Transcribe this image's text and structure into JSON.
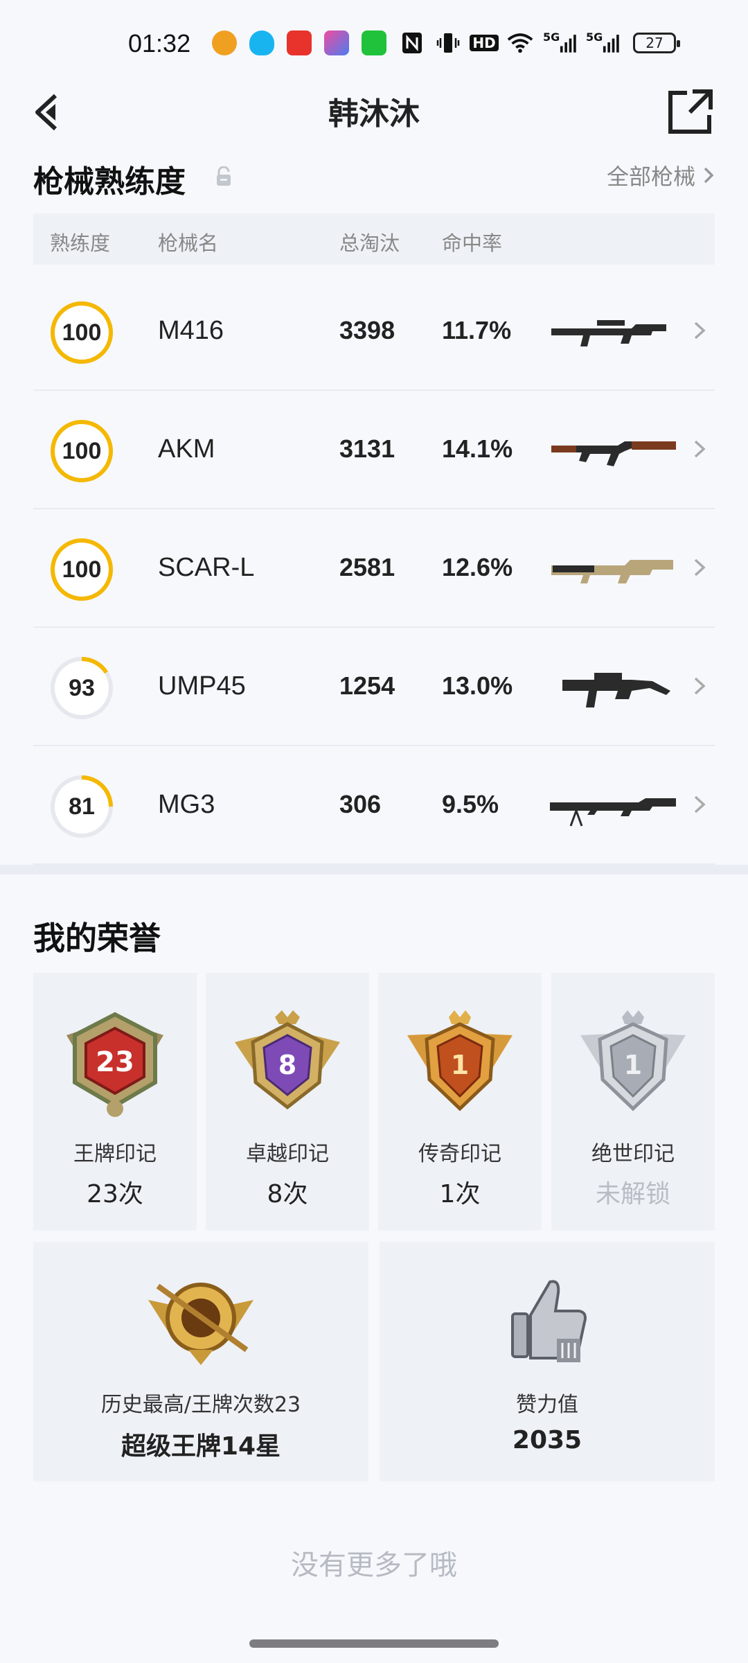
{
  "status_bar": {
    "time": "01:32",
    "icons": [
      "weibo-icon",
      "qq-icon",
      "red-packet-icon",
      "star-app-icon",
      "green-app-icon",
      "nfc-icon",
      "vibrate-icon",
      "hd-icon",
      "wifi-icon",
      "5g-signal-icon",
      "5g-signal-icon"
    ],
    "hd_label": "HD",
    "signal_label": "5G",
    "battery": "27"
  },
  "nav": {
    "title": "韩沐沐"
  },
  "weapons": {
    "title": "枪械熟练度",
    "all_label": "全部枪械",
    "headers": {
      "mastery": "熟练度",
      "name": "枪械名",
      "kills": "总淘汰",
      "accuracy": "命中率"
    },
    "rows": [
      {
        "mastery": "100",
        "mastery_fraction": 1.0,
        "name": "M416",
        "kills": "3398",
        "accuracy": "11.7%",
        "gun_icon": "m416-rifle-icon"
      },
      {
        "mastery": "100",
        "mastery_fraction": 1.0,
        "name": "AKM",
        "kills": "3131",
        "accuracy": "14.1%",
        "gun_icon": "akm-rifle-icon"
      },
      {
        "mastery": "100",
        "mastery_fraction": 1.0,
        "name": "SCAR-L",
        "kills": "2581",
        "accuracy": "12.6%",
        "gun_icon": "scar-rifle-icon"
      },
      {
        "mastery": "93",
        "mastery_fraction": 0.16,
        "name": "UMP45",
        "kills": "1254",
        "accuracy": "13.0%",
        "gun_icon": "ump45-smg-icon"
      },
      {
        "mastery": "81",
        "mastery_fraction": 0.25,
        "name": "MG3",
        "kills": "306",
        "accuracy": "9.5%",
        "gun_icon": "mg3-machinegun-icon"
      }
    ]
  },
  "honors": {
    "title": "我的荣誉",
    "cards": [
      {
        "name": "王牌印记",
        "count": "23次",
        "badge_number": "23",
        "badge_icon": "ace-badge-icon"
      },
      {
        "name": "卓越印记",
        "count": "8次",
        "badge_number": "8",
        "badge_icon": "excellent-badge-icon"
      },
      {
        "name": "传奇印记",
        "count": "1次",
        "badge_number": "1",
        "badge_icon": "legend-badge-icon"
      },
      {
        "name": "绝世印记",
        "count": "未解锁",
        "badge_number": "1",
        "badge_icon": "peerless-badge-icon"
      }
    ],
    "highest": {
      "label": "历史最高/王牌次数23",
      "value": "超级王牌14星"
    },
    "likes": {
      "label": "赞力值",
      "value": "2035"
    }
  },
  "footer": {
    "no_more": "没有更多了哦"
  },
  "colors": {
    "accent_ring": "#f5b800",
    "ring_track": "#e6e8ee",
    "card_bg": "#eef1f6"
  }
}
